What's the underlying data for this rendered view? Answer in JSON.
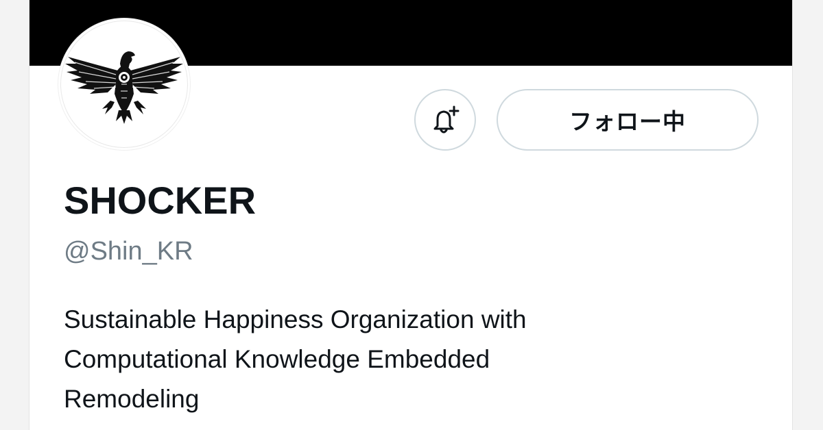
{
  "profile": {
    "display_name": "SHOCKER",
    "handle": "@Shin_KR",
    "bio_lines": [
      "Sustainable Happiness Organization with",
      "Computational Knowledge Embedded",
      "Remodeling"
    ]
  },
  "actions": {
    "follow_label": "フォロー中",
    "notify_icon": "bell-plus-icon"
  },
  "avatar": {
    "icon": "eagle-emblem-icon"
  },
  "colors": {
    "banner": "#000000",
    "text_primary": "#0f1419",
    "text_secondary": "#6e7b85",
    "button_border": "#cfd9de"
  }
}
